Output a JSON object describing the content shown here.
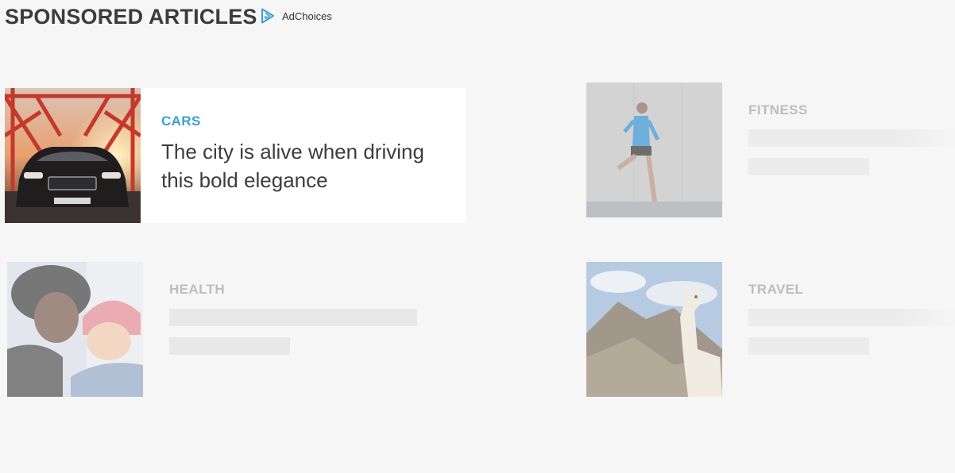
{
  "header": {
    "title": "SPONSORED ARTICLES",
    "adchoices_label": "AdChoices",
    "adchoices_icon": "adchoices-triangle-icon",
    "accent_color": "#3a9fd0"
  },
  "articles": [
    {
      "category": "CARS",
      "headline": "The city is alive when driving this bold elegance",
      "image": "car-on-bridge-image",
      "state": "active"
    },
    {
      "category": "FITNESS",
      "image": "runner-image",
      "state": "loading"
    },
    {
      "category": "HEALTH",
      "image": "mother-and-child-image",
      "state": "loading"
    },
    {
      "category": "TRAVEL",
      "image": "llama-mountain-image",
      "state": "loading"
    }
  ]
}
